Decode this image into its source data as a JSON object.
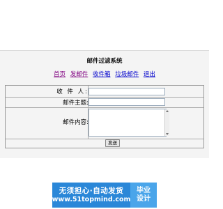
{
  "page": {
    "title": "邮件过滤系统"
  },
  "nav": [
    {
      "label": "首页"
    },
    {
      "label": "发邮件"
    },
    {
      "label": "收件箱"
    },
    {
      "label": "垃圾邮件"
    },
    {
      "label": "退出"
    }
  ],
  "form": {
    "recipient_label": "收 件 人:",
    "subject_label": "邮件主题:",
    "content_label": "邮件内容:",
    "recipient_value": "",
    "subject_value": "",
    "content_value": "",
    "send_label": "发送"
  },
  "banner": {
    "line1": "无须担心·自动发货",
    "line2": "www.51topmind.com",
    "right_line1": "毕业",
    "right_line2": "设计"
  }
}
